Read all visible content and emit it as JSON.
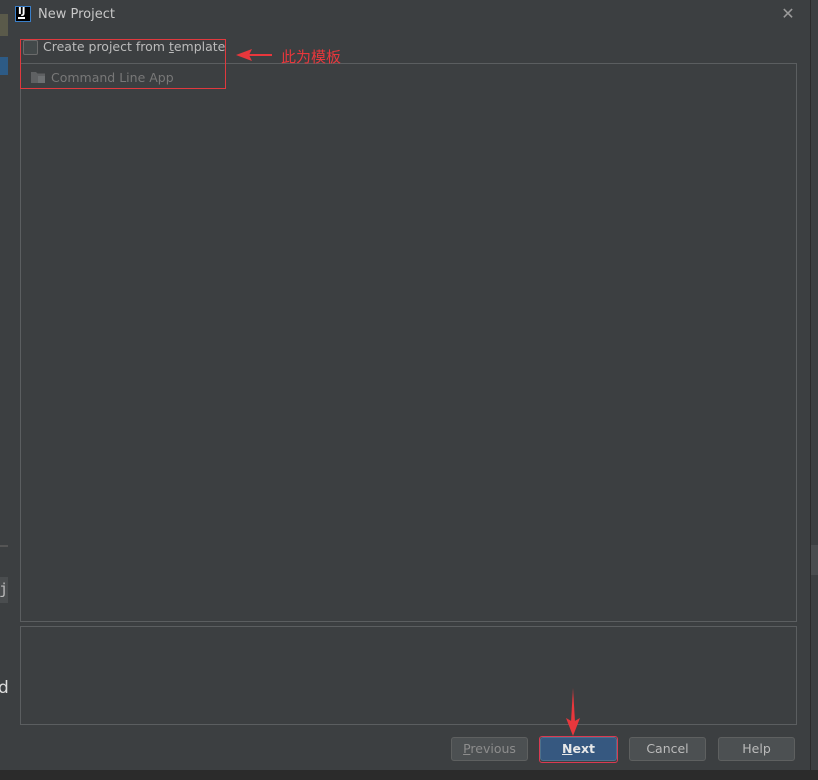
{
  "window": {
    "title": "New Project",
    "close_symbol": "✕"
  },
  "template": {
    "checkbox_label_pre": "Create project from ",
    "checkbox_label_u": "t",
    "checkbox_label_post": "emplate",
    "checked": false,
    "items": [
      {
        "label": "Command Line App",
        "icon": "folder-icon"
      }
    ]
  },
  "buttons": {
    "previous_u": "P",
    "previous_rest": "revious",
    "next_u": "N",
    "next_rest": "ext",
    "cancel": "Cancel",
    "help": "Help"
  },
  "annotation": {
    "label": "此为模板",
    "color": "#e8373c"
  },
  "background": {
    "left_glyph_1": "j",
    "left_glyph_2": "d"
  }
}
